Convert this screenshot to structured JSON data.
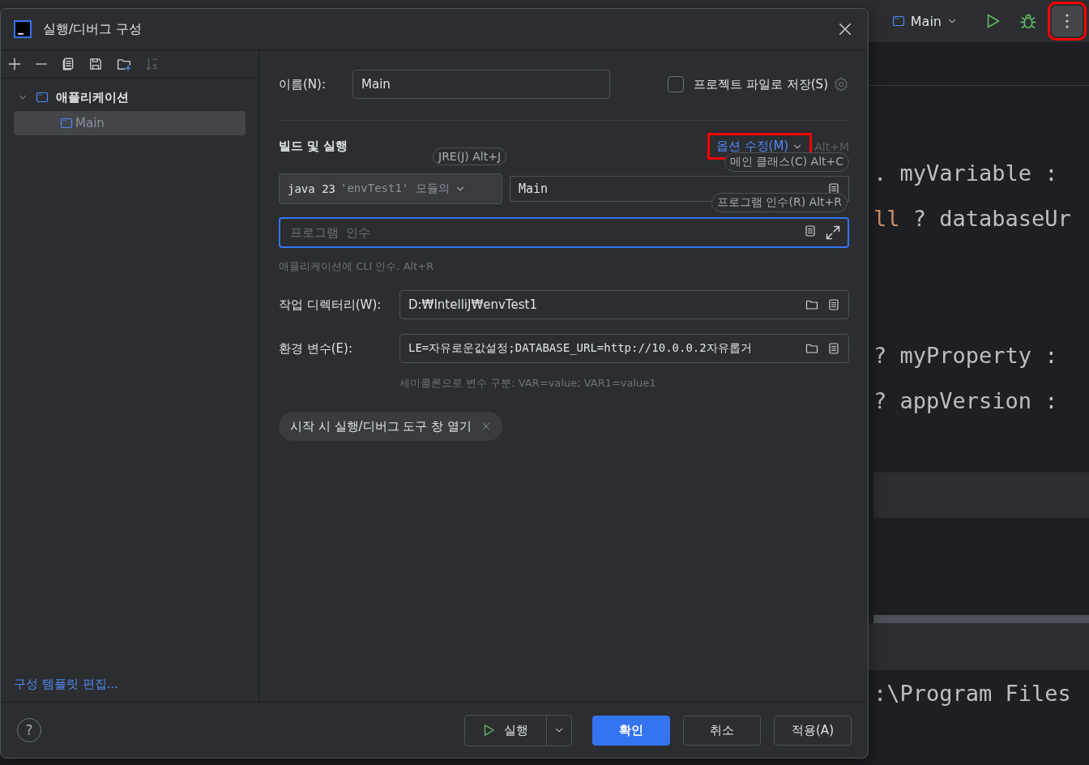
{
  "ide": {
    "run_config": "Main",
    "more_button": {
      "highlighted": true
    },
    "code_blocks": [
      [
        {
          "segments": [
            {
              "text": ". myVariable :",
              "kind": "plain"
            }
          ]
        },
        {
          "segments": [
            {
              "text": "ll",
              "kind": "keyword"
            },
            {
              "text": " ? databaseUr",
              "kind": "plain"
            }
          ]
        }
      ],
      [
        {
          "segments": [
            {
              "text": "? myProperty :",
              "kind": "plain"
            }
          ]
        },
        {
          "segments": [
            {
              "text": "? appVersion :",
              "kind": "plain"
            }
          ]
        }
      ]
    ],
    "terminal_line": ":\\Program Files"
  },
  "dialog": {
    "title": "실행/디버그 구성",
    "tree": [
      {
        "label": "애플리케이션",
        "expanded": true,
        "selected": false,
        "children": [
          {
            "label": "Main",
            "selected": true
          }
        ]
      }
    ],
    "template_link": "구성 템플릿 편집...",
    "name_label": "이름(N):",
    "name_value": "Main",
    "store_checkbox": {
      "label": "프로젝트 파일로 저장(S)",
      "checked": false
    },
    "section_title": "빌드 및 실행",
    "modify_options": {
      "label": "옵션 수정(M)",
      "shortcut": "Alt+M",
      "highlighted": true
    },
    "jre": {
      "version": "java 23",
      "module": "'envTest1' 모듈의"
    },
    "main_class": "Main",
    "program_args": {
      "placeholder": "프로그램 인수",
      "hint": "애플리케이션에 CLI 인수. Alt+R"
    },
    "working_dir": {
      "label": "작업 디렉터리(W):",
      "value": "D:₩IntelliJ₩envTest1"
    },
    "env": {
      "label": "환경 변수(E):",
      "value": "LE=자유로운값설정;DATABASE_URL=http://10.0.0.2자유롭거",
      "hint": "세미콜론으로 변수 구분: VAR=value; VAR1=value1"
    },
    "chip": "시작 시 실행/디버그 도구 창 열기",
    "hints": [
      {
        "text": "JRE(J) Alt+J"
      },
      {
        "text": "메인 클래스(C) Alt+C"
      },
      {
        "text": "프로그램 인수(R) Alt+R"
      }
    ],
    "help": "?",
    "buttons": {
      "run": "실행",
      "ok": "확인",
      "cancel": "취소",
      "apply": "적용(A)"
    }
  }
}
